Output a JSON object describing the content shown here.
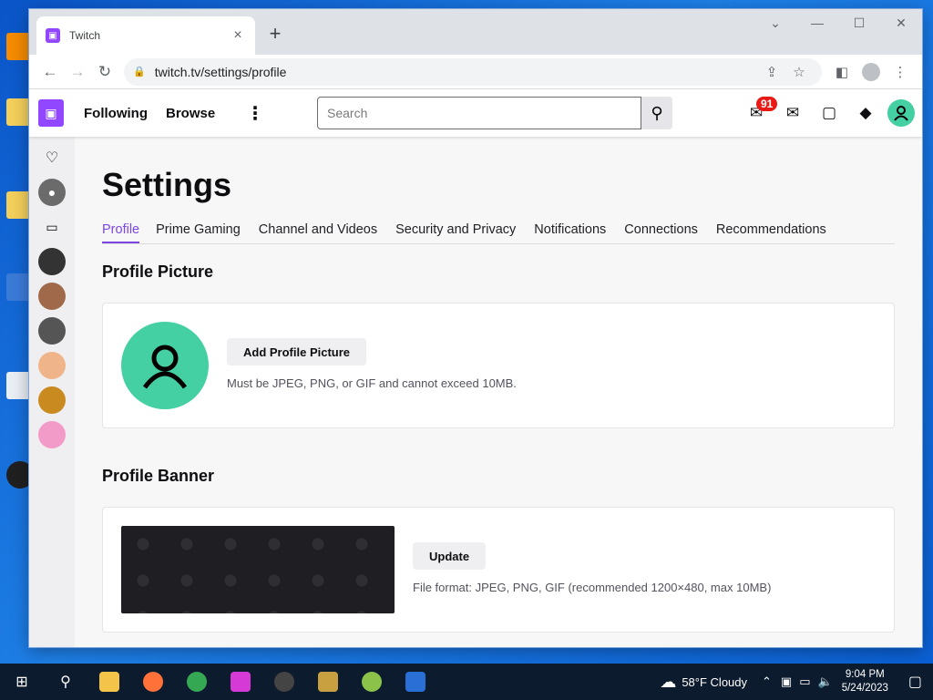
{
  "browser": {
    "tab_title": "Twitch",
    "tab_favicon": "twitch-logo",
    "url": "twitch.tv/settings/profile"
  },
  "twitch": {
    "nav_following": "Following",
    "nav_browse": "Browse",
    "search_placeholder": "Search",
    "notification_count": "91",
    "brand_color": "#9146ff",
    "avatar_color": "#45d0a3"
  },
  "settings": {
    "title": "Settings",
    "tabs": [
      {
        "label": "Profile",
        "active": true
      },
      {
        "label": "Prime Gaming"
      },
      {
        "label": "Channel and Videos"
      },
      {
        "label": "Security and Privacy"
      },
      {
        "label": "Notifications"
      },
      {
        "label": "Connections"
      },
      {
        "label": "Recommendations"
      }
    ],
    "profile_picture": {
      "heading": "Profile Picture",
      "button": "Add Profile Picture",
      "hint": "Must be JPEG, PNG, or GIF and cannot exceed 10MB."
    },
    "profile_banner": {
      "heading": "Profile Banner",
      "button": "Update",
      "hint": "File format: JPEG, PNG, GIF (recommended 1200×480, max 10MB)"
    }
  },
  "taskbar": {
    "weather": "58°F  Cloudy",
    "time": "9:04 PM",
    "date": "5/24/2023"
  }
}
